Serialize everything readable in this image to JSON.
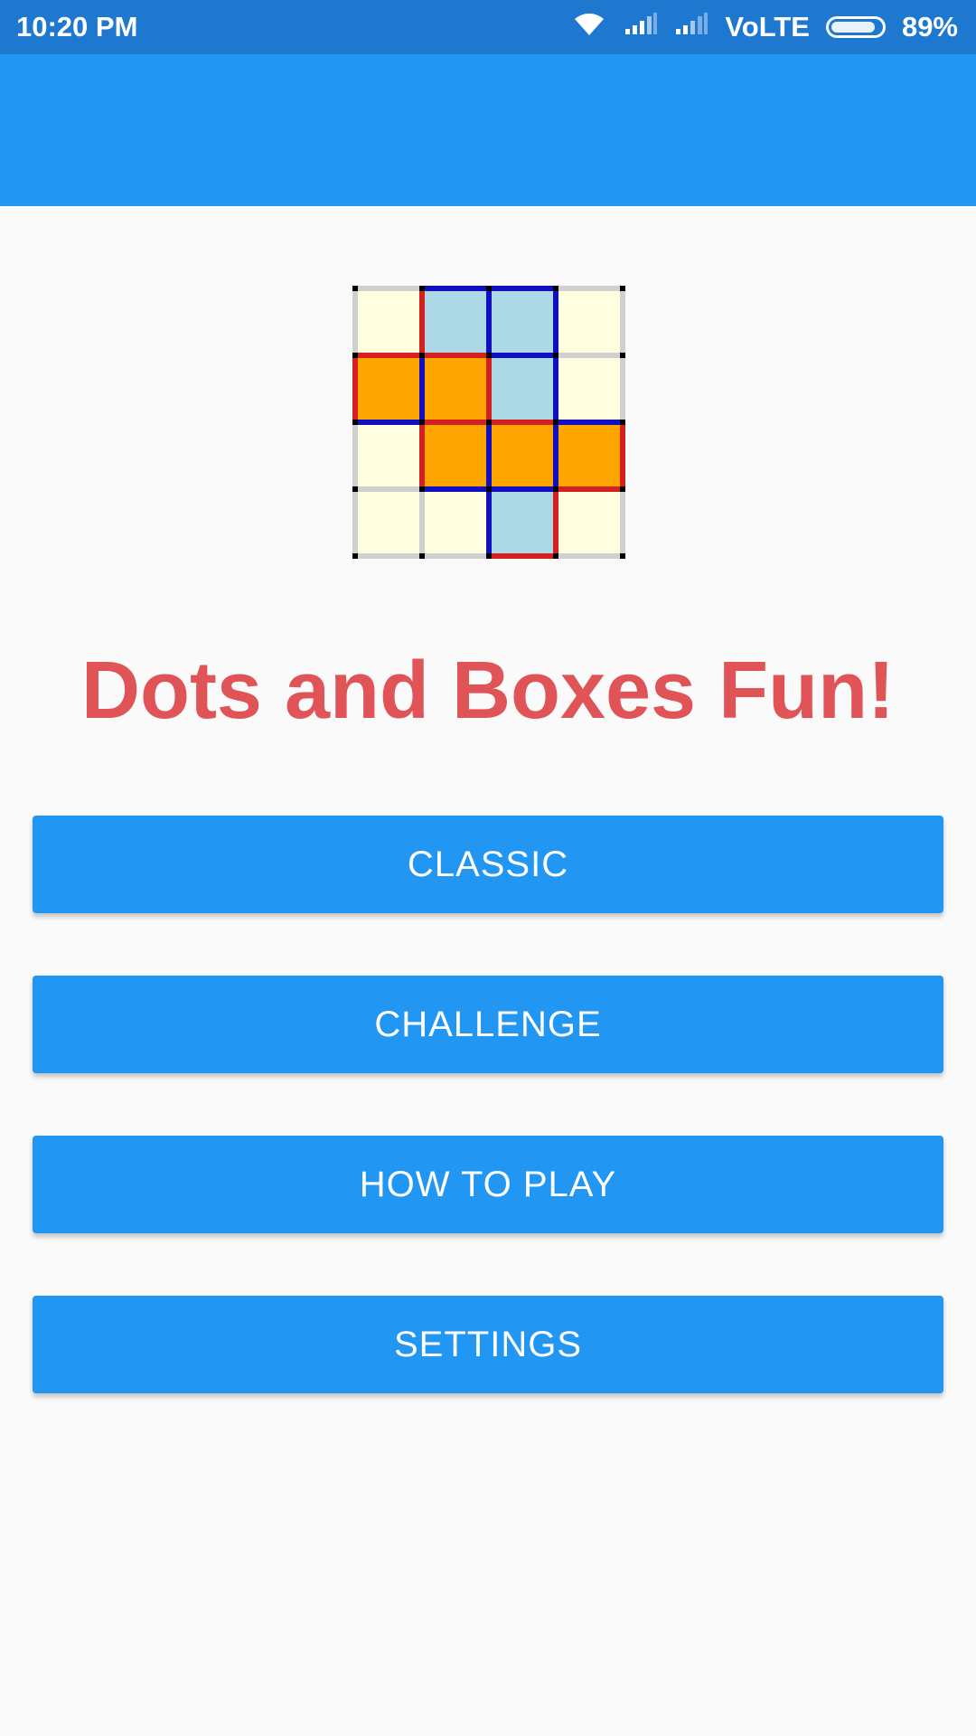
{
  "status_bar": {
    "time": "10:20 PM",
    "network": "VoLTE",
    "battery": "89%",
    "battery_level": 0.89,
    "icons": [
      "wifi-icon",
      "signal-icon",
      "signal-icon",
      "battery-icon"
    ]
  },
  "logo": {
    "description_icon": "dots-and-boxes-logo-icon",
    "colors": {
      "cream": "#ffffe0",
      "light_blue": "#add8e6",
      "orange": "#ffa500",
      "red_line": "#d42020",
      "blue_line": "#1010c0",
      "gray_line": "#d0d0d0",
      "dot": "#000000"
    },
    "boxes": [
      [
        "cream",
        "light_blue",
        "light_blue",
        "cream"
      ],
      [
        "orange",
        "orange",
        "light_blue",
        "cream"
      ],
      [
        "cream",
        "orange",
        "orange",
        "orange"
      ],
      [
        "cream",
        "cream",
        "light_blue",
        "cream"
      ]
    ],
    "h_lines": [
      [
        "gray",
        "blue",
        "blue",
        "gray"
      ],
      [
        "red",
        "red",
        "blue",
        "gray"
      ],
      [
        "blue",
        "red",
        "red",
        "blue"
      ],
      [
        "gray",
        "blue",
        "blue",
        "red"
      ],
      [
        "gray",
        "gray",
        "red",
        "gray"
      ]
    ],
    "v_lines": [
      [
        "gray",
        "red",
        "blue",
        "blue",
        "gray"
      ],
      [
        "red",
        "blue",
        "red",
        "blue",
        "gray"
      ],
      [
        "gray",
        "red",
        "blue",
        "blue",
        "red"
      ],
      [
        "gray",
        "gray",
        "blue",
        "red",
        "gray"
      ]
    ]
  },
  "title": "Dots and Boxes Fun!",
  "menu": {
    "classic": "CLASSIC",
    "challenge": "CHALLENGE",
    "how_to_play": "HOW TO PLAY",
    "settings": "SETTINGS"
  },
  "theme": {
    "primary": "#2196f3",
    "primary_dark": "#1e78d0",
    "title_color": "#e05458",
    "background": "#fafafa"
  }
}
